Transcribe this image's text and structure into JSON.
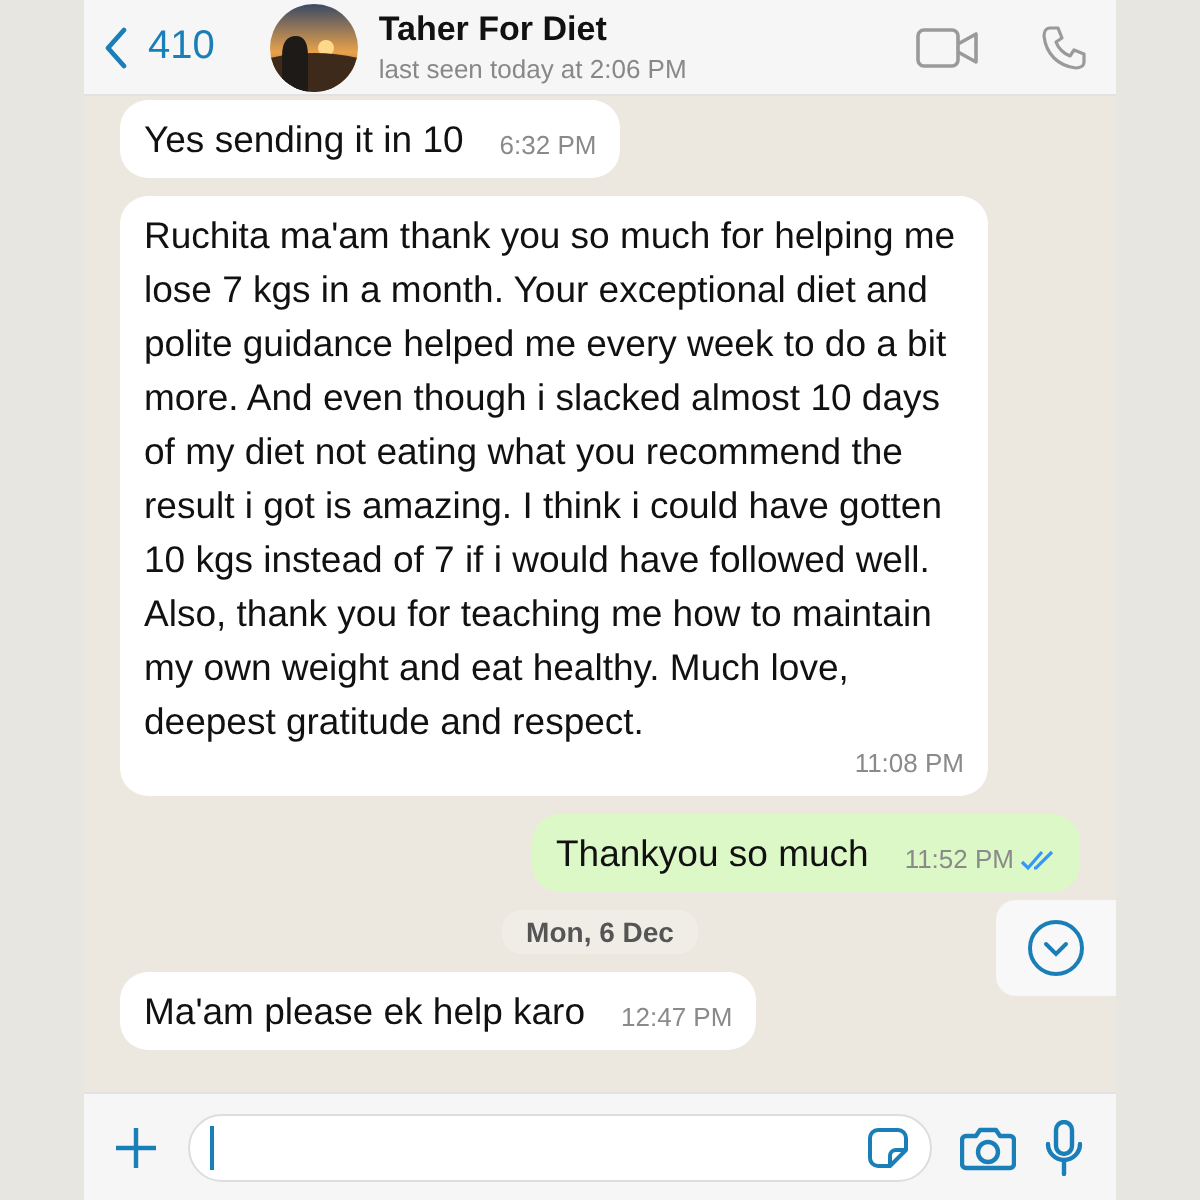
{
  "header": {
    "back_count": "410",
    "contact_name": "Taher For Diet",
    "last_seen": "last seen today at 2:06 PM"
  },
  "messages": [
    {
      "kind": "incoming",
      "text": "Yes sending it in 10",
      "time": "6:32 PM"
    },
    {
      "kind": "incoming",
      "text": "Ruchita ma'am thank you so much for helping me lose 7 kgs in a month. Your exceptional diet and polite guidance helped me every week to do a bit more. And even though i slacked almost 10 days of my diet not eating what you recommend the result i got is amazing. I think i could have gotten 10 kgs instead of 7 if i would have followed well. Also, thank you for teaching me how to maintain my own weight and eat healthy. Much love, deepest gratitude and respect.",
      "time": "11:08 PM"
    },
    {
      "kind": "outgoing",
      "text": "Thankyou so much",
      "time": "11:52 PM",
      "read": true
    },
    {
      "kind": "date",
      "text": "Mon, 6 Dec"
    },
    {
      "kind": "incoming",
      "text": "Ma'am please ek help karo",
      "time": "12:47 PM"
    }
  ]
}
